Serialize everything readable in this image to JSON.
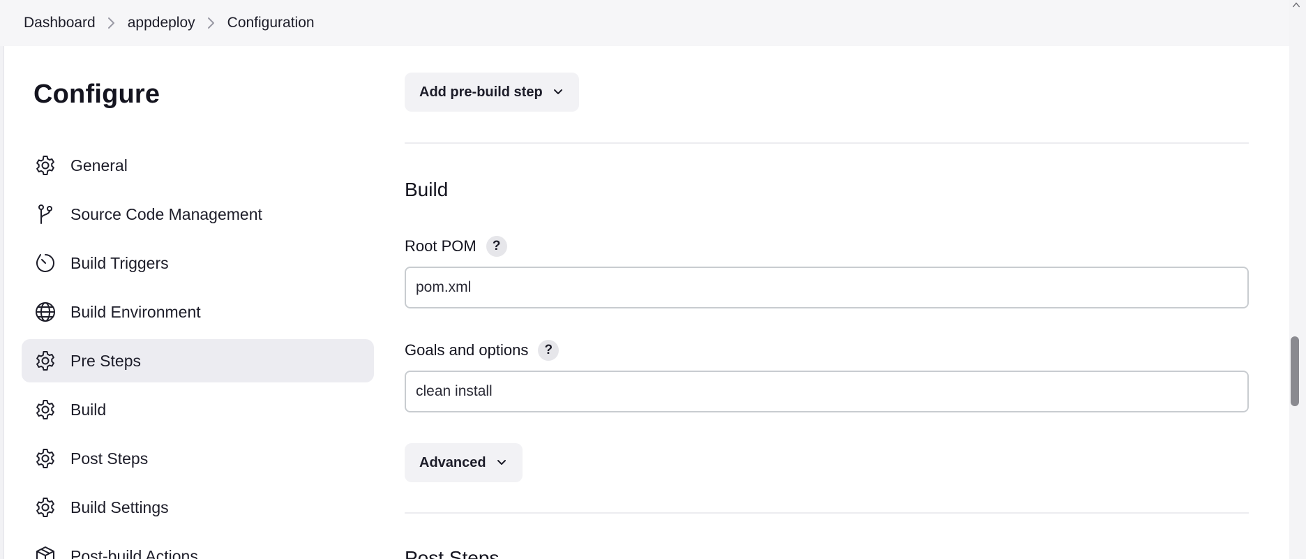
{
  "breadcrumb": {
    "items": [
      {
        "label": "Dashboard"
      },
      {
        "label": "appdeploy"
      },
      {
        "label": "Configuration"
      }
    ]
  },
  "sidebar": {
    "title": "Configure",
    "items": [
      {
        "label": "General",
        "icon": "gear-icon"
      },
      {
        "label": "Source Code Management",
        "icon": "branch-icon"
      },
      {
        "label": "Build Triggers",
        "icon": "clock-icon"
      },
      {
        "label": "Build Environment",
        "icon": "globe-icon"
      },
      {
        "label": "Pre Steps",
        "icon": "gear-icon",
        "active": true
      },
      {
        "label": "Build",
        "icon": "gear-icon"
      },
      {
        "label": "Post Steps",
        "icon": "gear-icon"
      },
      {
        "label": "Build Settings",
        "icon": "gear-icon"
      },
      {
        "label": "Post-build Actions",
        "icon": "package-icon"
      }
    ]
  },
  "main": {
    "pre_build_button": "Add pre-build step",
    "build_section": {
      "title": "Build",
      "root_pom_label": "Root POM",
      "root_pom_value": "pom.xml",
      "goals_label": "Goals and options",
      "goals_value": "clean install",
      "help_glyph": "?",
      "advanced_button": "Advanced"
    },
    "next_section_title": "Post Steps"
  },
  "colors": {
    "active_nav_bg": "#ececf1",
    "button_bg": "#f2f2f5",
    "input_border": "#c8ccd0",
    "breadcrumb_bg": "#f6f6f8"
  }
}
